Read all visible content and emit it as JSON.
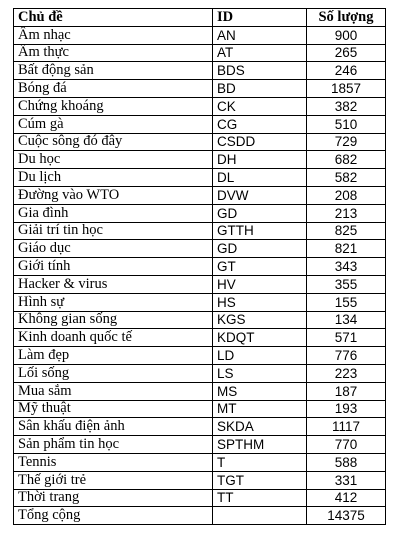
{
  "table": {
    "headers": [
      "Chủ đề",
      "ID",
      "Số lượng"
    ],
    "rows": [
      [
        "Âm nhạc",
        "AN",
        "900"
      ],
      [
        "Ẩm thực",
        "AT",
        "265"
      ],
      [
        "Bất động sản",
        "BDS",
        "246"
      ],
      [
        "Bóng đá",
        "BD",
        "1857"
      ],
      [
        "Chứng khoáng",
        "CK",
        "382"
      ],
      [
        "Cúm gà",
        "CG",
        "510"
      ],
      [
        "Cuộc sông đó đây",
        "CSDD",
        "729"
      ],
      [
        "Du học",
        "DH",
        "682"
      ],
      [
        "Du lịch",
        "DL",
        "582"
      ],
      [
        "Đường vào WTO",
        "DVW",
        "208"
      ],
      [
        "Gia đình",
        "GD",
        "213"
      ],
      [
        "Giải trí tin học",
        "GTTH",
        "825"
      ],
      [
        "Giáo dục",
        "GD",
        "821"
      ],
      [
        "Giới tính",
        "GT",
        "343"
      ],
      [
        "Hacker & virus",
        "HV",
        "355"
      ],
      [
        "Hình sự",
        "HS",
        "155"
      ],
      [
        "Không gian sống",
        "KGS",
        "134"
      ],
      [
        "Kinh doanh quốc tế",
        "KDQT",
        "571"
      ],
      [
        "Làm đẹp",
        "LD",
        "776"
      ],
      [
        "Lối sống",
        "LS",
        "223"
      ],
      [
        "Mua sắm",
        "MS",
        "187"
      ],
      [
        "Mỹ thuật",
        "MT",
        "193"
      ],
      [
        "Sân khấu điện ảnh",
        "SKDA",
        "1117"
      ],
      [
        "Sản phẩm tin học",
        "SPTHM",
        "770"
      ],
      [
        "Tennis",
        "T",
        "588"
      ],
      [
        "Thế giới trẻ",
        "TGT",
        "331"
      ],
      [
        "Thời trang",
        "TT",
        "412"
      ],
      [
        "Tổng cộng",
        "",
        "14375"
      ]
    ]
  }
}
